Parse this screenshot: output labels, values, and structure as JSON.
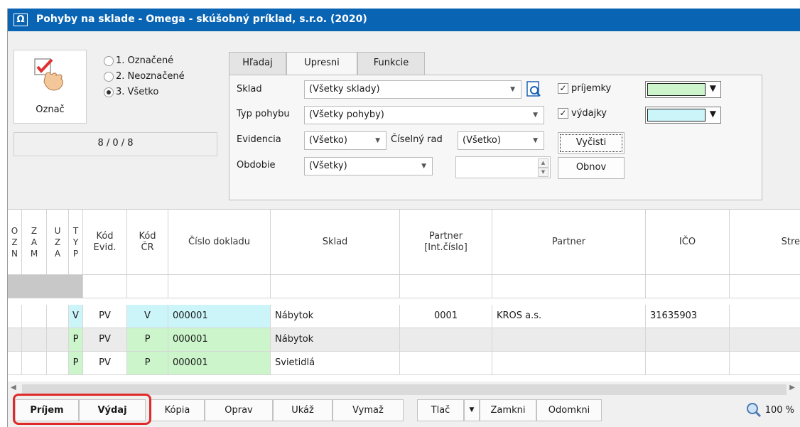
{
  "window": {
    "title": "Pohyby na sklade - Omega - skúšobný príklad, s.r.o. (2020)",
    "icon_glyph": "Ω"
  },
  "mark": {
    "button_label": "Označ",
    "radios": [
      {
        "label": "1. Označené",
        "selected": false
      },
      {
        "label": "2. Neoznačené",
        "selected": false
      },
      {
        "label": "3. Všetko",
        "selected": true
      }
    ],
    "counter": "8 / 0 / 8"
  },
  "tabs": [
    {
      "label": "Hľadaj",
      "active": false
    },
    {
      "label": "Upresni",
      "active": true
    },
    {
      "label": "Funkcie",
      "active": false
    }
  ],
  "filters": {
    "sklad_label": "Sklad",
    "sklad_value": "(Všetky sklady)",
    "typ_label": "Typ pohybu",
    "typ_value": "(Všetky pohyby)",
    "evidencia_label": "Evidencia",
    "evidencia_value": "(Všetko)",
    "ciselny_label": "Číselný rad",
    "ciselny_value": "(Všetko)",
    "obdobie_label": "Obdobie",
    "obdobie_value": "(Všetky)",
    "prijemky_label": "príjemky",
    "vydajky_label": "výdajky",
    "prijemky_color": "#ccf5cc",
    "vydajky_color": "#ccf5fa",
    "vycisti_label": "Vyčisti",
    "obnov_label": "Obnov"
  },
  "grid": {
    "columns": [
      "O\nZ\nN",
      "Z\nA\nM",
      "U\nZ\nA",
      "T\nY\nP",
      "Kód\nEvid.",
      "Kód\nČR",
      "Číslo dokladu",
      "Sklad",
      "Partner\n[Int.číslo]",
      "Partner",
      "IČO",
      "Stre"
    ],
    "rows": [
      {
        "typ": "V",
        "kod_evid": "PV",
        "kod_cr": "V",
        "cislo": "000001",
        "sklad": "Nábytok",
        "partner_int": "0001",
        "partner": "KROS a.s.",
        "ico": "31635903",
        "color": "#ccf5fa"
      },
      {
        "typ": "P",
        "kod_evid": "PV",
        "kod_cr": "P",
        "cislo": "000001",
        "sklad": "Nábytok",
        "partner_int": "",
        "partner": "",
        "ico": "",
        "color": "#ccf5cc"
      },
      {
        "typ": "P",
        "kod_evid": "PV",
        "kod_cr": "P",
        "cislo": "000001",
        "sklad": "Svietidlá",
        "partner_int": "",
        "partner": "",
        "ico": "",
        "color": "#ccf5cc"
      }
    ]
  },
  "toolbar": {
    "prijem": "Príjem",
    "vydaj": "Výdaj",
    "kopia": "Kópia",
    "oprav": "Oprav",
    "ukaz": "Ukáž",
    "vymaz": "Vymaž",
    "tlac": "Tlač",
    "zamkni": "Zamkni",
    "odomkni": "Odomkni",
    "zoom": "100 %"
  },
  "colors": {
    "title_bar": "#0a64b4",
    "highlight": "#e02a2a"
  }
}
